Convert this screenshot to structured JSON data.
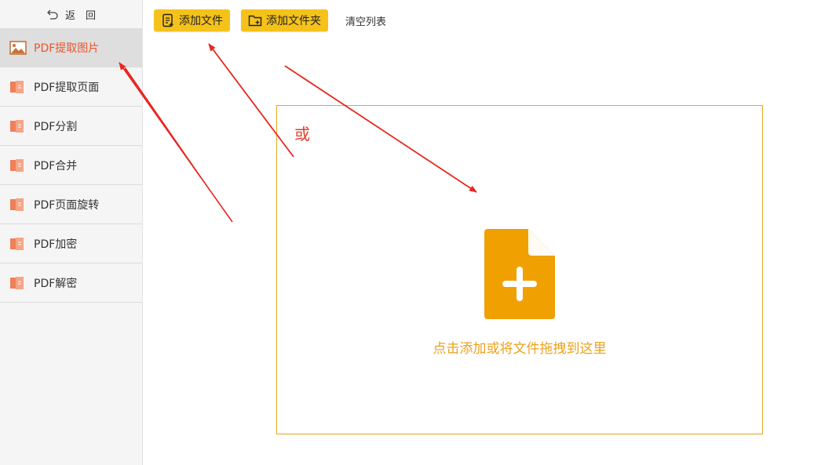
{
  "sidebar": {
    "back_label": "返　回",
    "items": [
      {
        "label": "PDF提取图片",
        "icon": "image-icon",
        "active": true
      },
      {
        "label": "PDF提取页面",
        "icon": "pdf-file-icon"
      },
      {
        "label": "PDF分割",
        "icon": "pdf-file-icon"
      },
      {
        "label": "PDF合并",
        "icon": "pdf-file-icon"
      },
      {
        "label": "PDF页面旋转",
        "icon": "pdf-file-icon"
      },
      {
        "label": "PDF加密",
        "icon": "pdf-file-icon"
      },
      {
        "label": "PDF解密",
        "icon": "pdf-file-icon"
      }
    ]
  },
  "toolbar": {
    "add_file_label": "添加文件",
    "add_folder_label": "添加文件夹",
    "clear_label": "清空列表"
  },
  "dropzone": {
    "or_label": "或",
    "hint": "点击添加或将文件拖拽到这里"
  },
  "colors": {
    "accent_yellow": "#f5c21b",
    "active_text": "#e8562d",
    "dropzone_border": "#e2aa1a",
    "file_icon": "#f0a000",
    "arrow": "#e8261f"
  }
}
